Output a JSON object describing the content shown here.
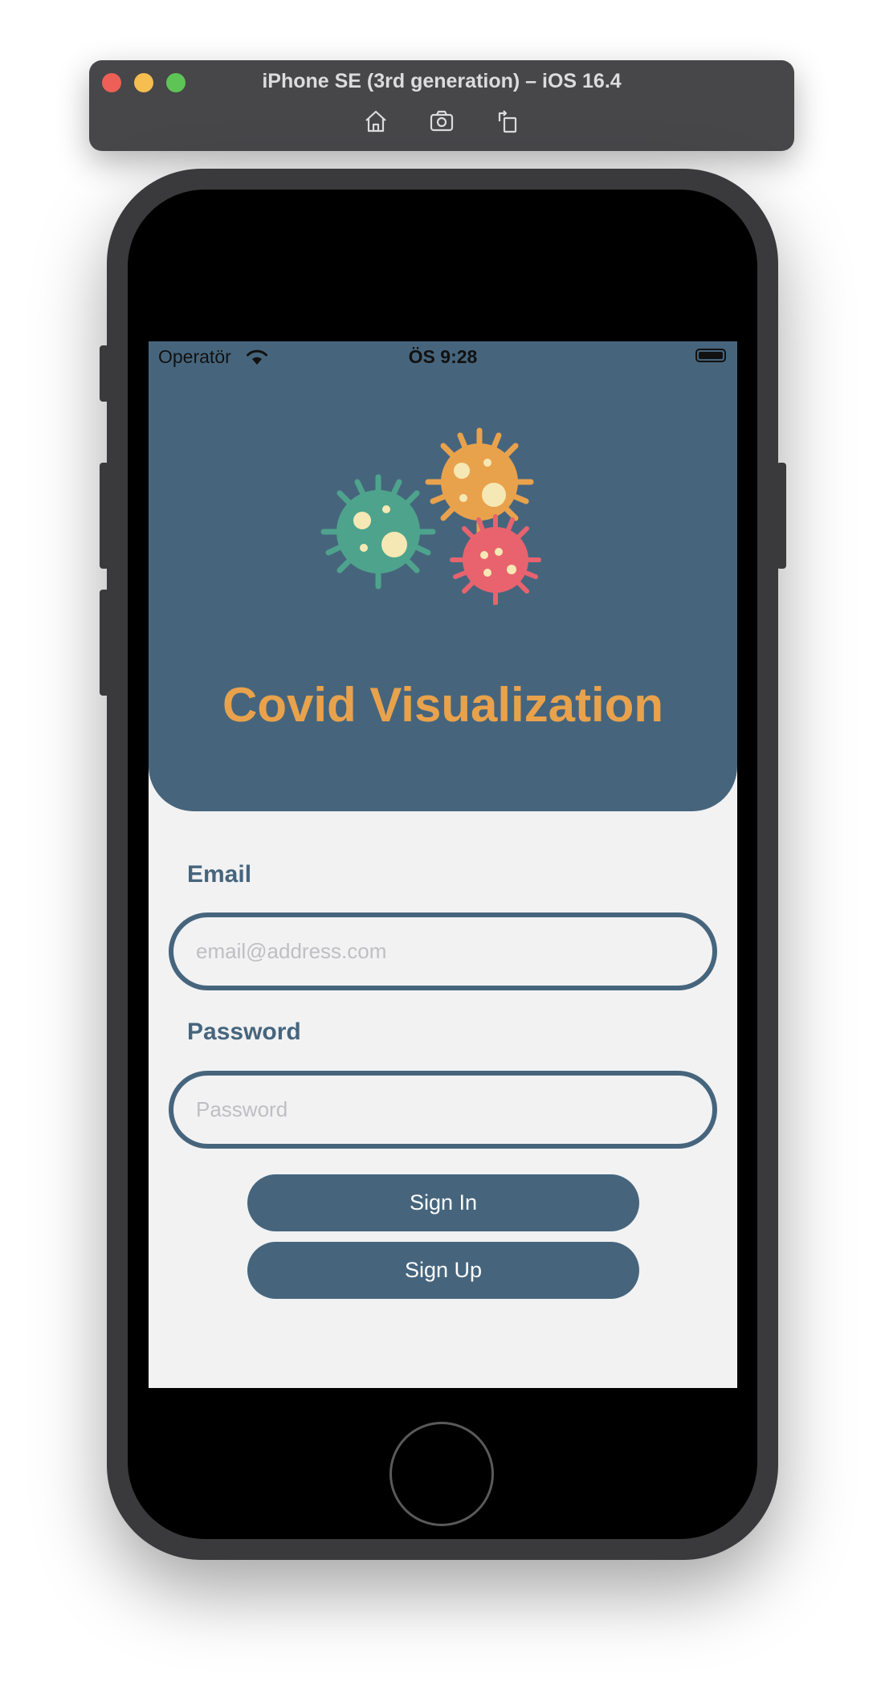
{
  "simulator": {
    "title": "iPhone SE (3rd generation) – iOS 16.4",
    "toolbar_icons": [
      "home-icon",
      "screenshot-icon",
      "rotate-icon"
    ]
  },
  "status_bar": {
    "carrier": "Operatör",
    "time": "ÖS 9:28"
  },
  "app": {
    "title": "Covid Visualization",
    "logo": "virus-icon",
    "colors": {
      "primary": "#46657d",
      "title_orange": "#e9a24c",
      "virus_green": "#4ea38c",
      "virus_orange": "#e9a24c",
      "virus_red": "#e8636e",
      "background": "#f2f2f3"
    }
  },
  "form": {
    "email_label": "Email",
    "email_placeholder": "email@address.com",
    "email_value": "",
    "password_label": "Password",
    "password_placeholder": "Password",
    "password_value": "",
    "signin_label": "Sign In",
    "signup_label": "Sign Up"
  }
}
